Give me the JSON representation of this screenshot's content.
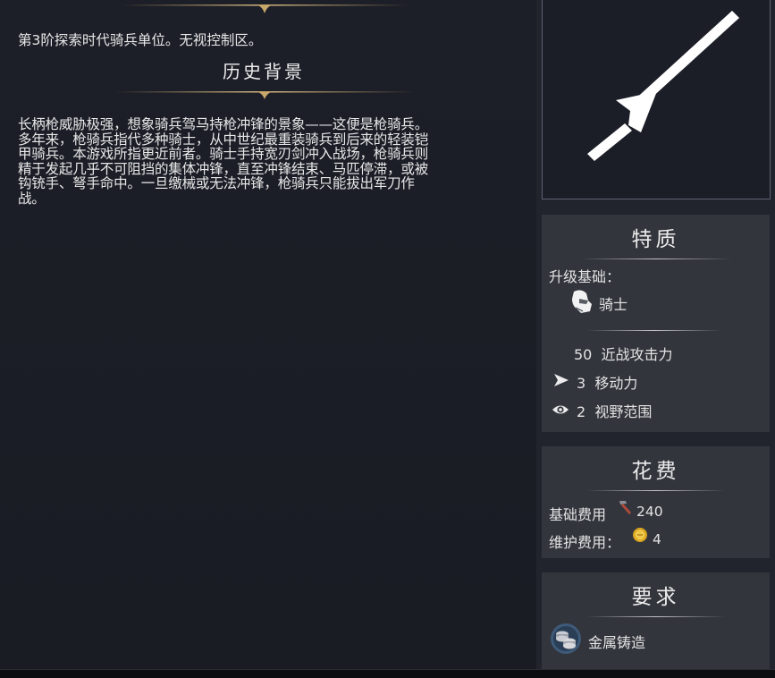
{
  "unit": {
    "description": "第3阶探索时代骑兵单位。无视控制区。",
    "history_heading": "历史背景",
    "history_lines": [
      "长柄枪威胁极强，想象骑兵驾马持枪冲锋的景象——这便是枪骑兵。",
      "多年来，枪骑兵指代多种骑士，从中世纪最重装骑兵到后来的轻装铠",
      "甲骑兵。本游戏所指更近前者。骑士手持宽刃剑冲入战场，枪骑兵则",
      "精于发起几乎不可阻挡的集体冲锋，直至冲锋结束、马匹停滞，或被",
      "钩铳手、弩手命中。一旦缴械或无法冲锋，枪骑兵只能拔出军刀作",
      "战。"
    ],
    "portrait_icon": "lance-icon"
  },
  "traits": {
    "title": "特质",
    "upgrade_label": "升级基础：",
    "upgrade_unit": "骑士",
    "upgrade_icon": "knight-helmet-icon",
    "melee": "50",
    "melee_label": "近战攻击力",
    "movement": "3",
    "movement_label": "移动力",
    "vision": "2",
    "vision_label": "视野范围"
  },
  "cost": {
    "title": "花费",
    "base_label": "基础费用",
    "base_value": "240",
    "base_icon": "hammer-icon",
    "upkeep_label": "维护费用：",
    "upkeep_value": "4",
    "upkeep_icon": "gold-coin-icon"
  },
  "requirements": {
    "title": "要求",
    "tech": "金属铸造",
    "tech_icon": "metal-casting-icon"
  },
  "colors": {
    "background": "#1b1d25",
    "panel": "#33353d",
    "ornament_gold": "#c8a86a",
    "text": "#e8e8e8"
  }
}
